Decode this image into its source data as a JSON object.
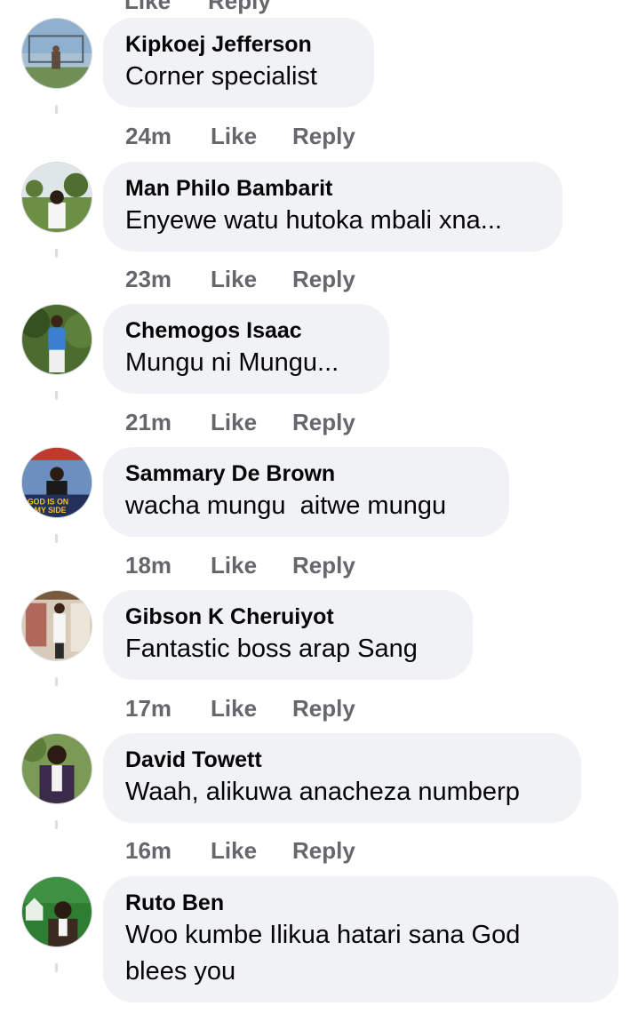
{
  "top_partial": {
    "like_label": "Like",
    "reply_label": "Reply"
  },
  "comments": [
    {
      "name": "Kipkoej Jefferson",
      "text": "Corner specialist",
      "time": "24m",
      "like": "Like",
      "reply": "Reply",
      "avatar_colors": [
        "#6f8aa3",
        "#b9c8b1",
        "#4a5a3a"
      ]
    },
    {
      "name": "Man Philo Bambarit",
      "text": "Enyewe watu hutoka mbali xna...",
      "time": "23m",
      "like": "Like",
      "reply": "Reply",
      "avatar_colors": [
        "#cfd8dc",
        "#5e7d3a",
        "#2b2b2b"
      ]
    },
    {
      "name": "Chemogos Isaac",
      "text": "Mungu ni Mungu...",
      "time": "21m",
      "like": "Like",
      "reply": "Reply",
      "avatar_colors": [
        "#3d5a2a",
        "#6e8f3e",
        "#3b6fb5"
      ]
    },
    {
      "name": "Sammary De Brown",
      "text": "wacha mungu  aitwe mungu",
      "time": "18m",
      "like": "Like",
      "reply": "Reply",
      "avatar_colors": [
        "#1e3a6e",
        "#f4c21b",
        "#c0392b"
      ],
      "avatar_text": [
        "GOD IS ON",
        "MY SIDE"
      ]
    },
    {
      "name": "Gibson K Cheruiyot",
      "text": "Fantastic boss arap Sang",
      "time": "17m",
      "like": "Like",
      "reply": "Reply",
      "avatar_colors": [
        "#c9b9a6",
        "#8a6e55",
        "#f2f2f2"
      ]
    },
    {
      "name": "David Towett",
      "text": "Waah, alikuwa anacheza numberp",
      "time": "16m",
      "like": "Like",
      "reply": "Reply",
      "avatar_colors": [
        "#6d8c4a",
        "#3b2a4a",
        "#e9e9e9"
      ]
    },
    {
      "name": "Ruto Ben",
      "text": "Woo kumbe Ilikua hatari sana God\nblees you",
      "time": "",
      "like": "",
      "reply": "",
      "avatar_colors": [
        "#2e7d32",
        "#e0e0e0",
        "#3a2a20"
      ]
    }
  ]
}
